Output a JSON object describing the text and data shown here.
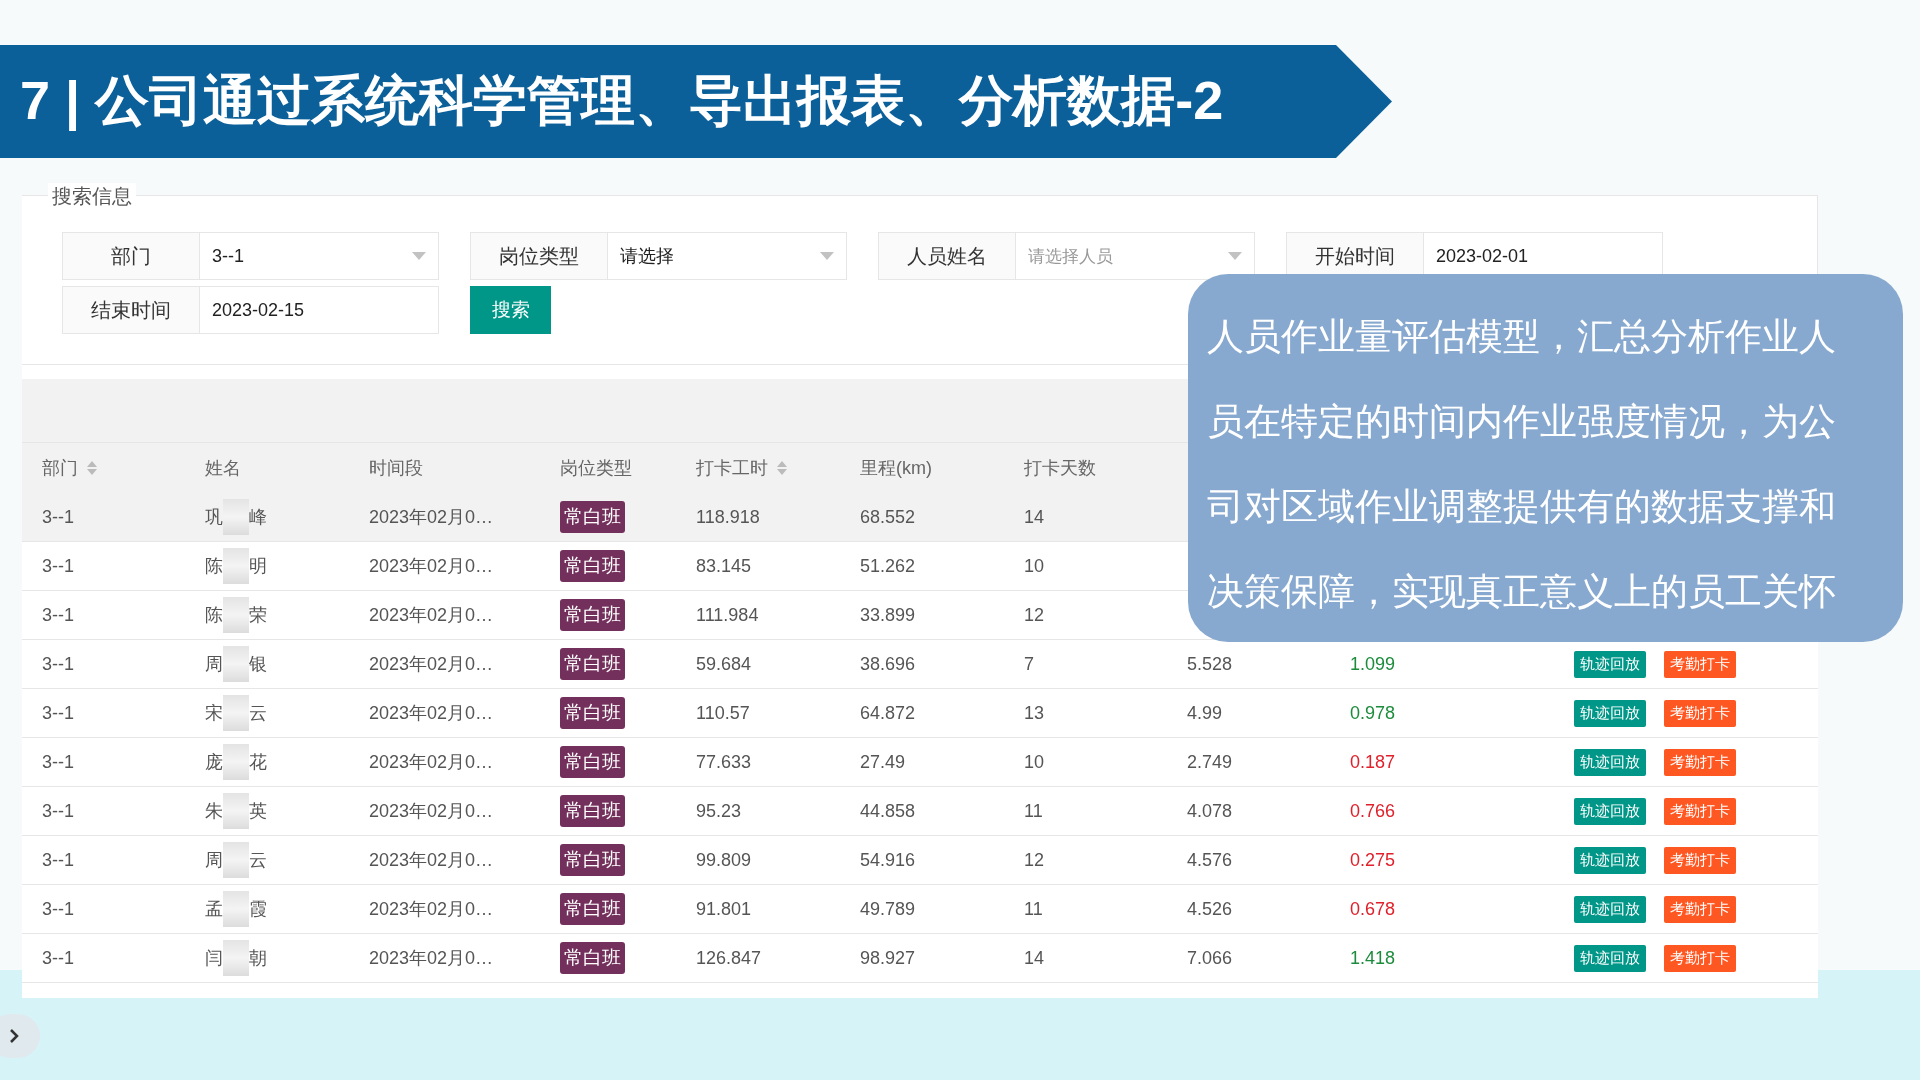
{
  "slide": {
    "title": "7 | 公司通过系统科学管理、导出报表、分析数据-2",
    "callout": "人员作业量评估模型，汇总分析作业人员在特定的时间内作业强度情况，为公司对区域作业调整提供有的数据支撑和决策保障，实现真正意义上的员工关怀"
  },
  "search": {
    "legend": "搜索信息",
    "button": "搜索",
    "fields": [
      {
        "label": "部门",
        "value": "3--1",
        "kind": "select"
      },
      {
        "label": "岗位类型",
        "value": "请选择",
        "kind": "select"
      },
      {
        "label": "人员姓名",
        "placeholder": "请选择人员",
        "kind": "select"
      },
      {
        "label": "开始时间",
        "value": "2023-02-01",
        "kind": "date"
      },
      {
        "label": "结束时间",
        "value": "2023-02-15",
        "kind": "date"
      }
    ]
  },
  "table": {
    "columns": [
      {
        "label": "部门",
        "sortable": true
      },
      {
        "label": "姓名",
        "sortable": false
      },
      {
        "label": "时间段",
        "sortable": false
      },
      {
        "label": "岗位类型",
        "sortable": false
      },
      {
        "label": "打卡工时",
        "sortable": true
      },
      {
        "label": "里程(km)",
        "sortable": false
      },
      {
        "label": "打卡天数",
        "sortable": false
      }
    ],
    "rows": [
      {
        "selected": true,
        "dept": "3--1",
        "name": [
          "巩",
          "峰"
        ],
        "period": "2023年02月0…",
        "post": "常白班",
        "hours": "118.918",
        "km": "68.552",
        "days": "14"
      },
      {
        "selected": false,
        "dept": "3--1",
        "name": [
          "陈",
          "明"
        ],
        "period": "2023年02月0…",
        "post": "常白班",
        "hours": "83.145",
        "km": "51.262",
        "days": "10"
      },
      {
        "selected": false,
        "dept": "3--1",
        "name": [
          "陈",
          "荣"
        ],
        "period": "2023年02月0…",
        "post": "常白班",
        "hours": "111.984",
        "km": "33.899",
        "days": "12"
      },
      {
        "selected": false,
        "dept": "3--1",
        "name": [
          "周",
          "银"
        ],
        "period": "2023年02月0…",
        "post": "常白班",
        "hours": "59.684",
        "km": "38.696",
        "days": "7",
        "avg": "5.528",
        "activity": "1.099",
        "color": "#1c8c3c",
        "actions": [
          "轨迹回放",
          "考勤打卡"
        ]
      },
      {
        "selected": false,
        "dept": "3--1",
        "name": [
          "宋",
          "云"
        ],
        "period": "2023年02月0…",
        "post": "常白班",
        "hours": "110.57",
        "km": "64.872",
        "days": "13",
        "avg": "4.99",
        "activity": "0.978",
        "color": "#1c8c3c",
        "actions": [
          "轨迹回放",
          "考勤打卡"
        ]
      },
      {
        "selected": false,
        "dept": "3--1",
        "name": [
          "庞",
          "花"
        ],
        "period": "2023年02月0…",
        "post": "常白班",
        "hours": "77.633",
        "km": "27.49",
        "days": "10",
        "avg": "2.749",
        "activity": "0.187",
        "color": "#e0202a",
        "actions": [
          "轨迹回放",
          "考勤打卡"
        ]
      },
      {
        "selected": false,
        "dept": "3--1",
        "name": [
          "朱",
          "英"
        ],
        "period": "2023年02月0…",
        "post": "常白班",
        "hours": "95.23",
        "km": "44.858",
        "days": "11",
        "avg": "4.078",
        "activity": "0.766",
        "color": "#e0202a",
        "actions": [
          "轨迹回放",
          "考勤打卡"
        ]
      },
      {
        "selected": false,
        "dept": "3--1",
        "name": [
          "周",
          "云"
        ],
        "period": "2023年02月0…",
        "post": "常白班",
        "hours": "99.809",
        "km": "54.916",
        "days": "12",
        "avg": "4.576",
        "activity": "0.275",
        "color": "#e0202a",
        "actions": [
          "轨迹回放",
          "考勤打卡"
        ]
      },
      {
        "selected": false,
        "dept": "3--1",
        "name": [
          "孟",
          "霞"
        ],
        "period": "2023年02月0…",
        "post": "常白班",
        "hours": "91.801",
        "km": "49.789",
        "days": "11",
        "avg": "4.526",
        "activity": "0.678",
        "color": "#e0202a",
        "actions": [
          "轨迹回放",
          "考勤打卡"
        ]
      },
      {
        "selected": false,
        "dept": "3--1",
        "name": [
          "闫",
          "朝"
        ],
        "period": "2023年02月0…",
        "post": "常白班",
        "hours": "126.847",
        "km": "98.927",
        "days": "14",
        "avg": "7.066",
        "activity": "1.418",
        "color": "#1c8c3c",
        "actions": [
          "轨迹回放",
          "考勤打卡"
        ]
      }
    ]
  }
}
